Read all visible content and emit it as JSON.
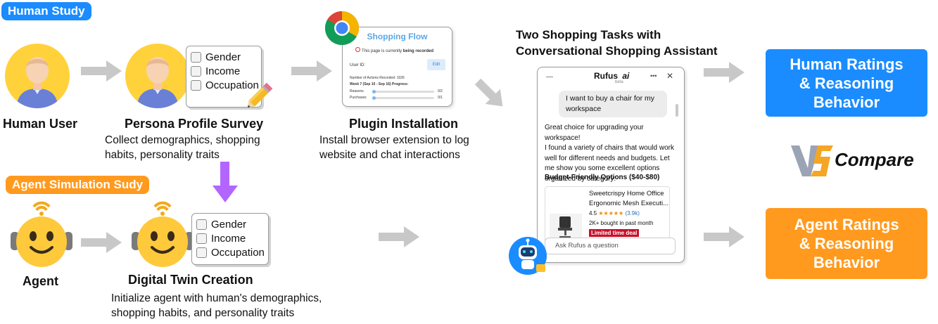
{
  "human_study_tag": "Human Study",
  "agent_study_tag": "Agent Simulation Sudy",
  "human_user_label": "Human User",
  "agent_label": "Agent",
  "persona_survey": {
    "title": "Persona Profile Survey",
    "desc_line1": "Collect demographics, shopping",
    "desc_line2": "habits, personality traits",
    "fields": [
      "Gender",
      "Income",
      "Occupation"
    ]
  },
  "digital_twin": {
    "title": "Digital Twin Creation",
    "desc_line1": "Initialize agent with human's demographics,",
    "desc_line2": "shopping habits, and personality traits",
    "fields": [
      "Gender",
      "Income",
      "Occupation"
    ]
  },
  "plugin": {
    "title": "Plugin Installation",
    "desc_line1": "Install browser extension to log",
    "desc_line2": "website and chat interactions",
    "screenshot": {
      "title": "Shopping Flow",
      "recording_prefix": "This page is currently ",
      "recording_bold": "being recorded",
      "user_id_label": "User ID:",
      "edit_button": "Edit",
      "actions_recorded": "Number of Actions Recorded: 1026",
      "week_progress": "Week 7 (Sep 10 - Sep 16) Progress:",
      "reasons_label": "Reasons",
      "reasons_count": "0/2",
      "purchases_label": "Purchases",
      "purchases_count": "0/1"
    }
  },
  "shopping_tasks": {
    "title_line1": "Two Shopping Tasks with",
    "title_line2": "Conversational Shopping Assistant"
  },
  "rufus": {
    "name": "Rufus",
    "logo_mark": "ai",
    "badge": "beta",
    "menu_glyph": "•••",
    "close_glyph": "✕",
    "minimize_glyph": "—",
    "user_msg_line1": "I want to buy a chair for my",
    "user_msg_line2": "workspace",
    "reply_lines": [
      "Great choice for upgrading your workspace!",
      "I found a variety of chairs that would work",
      "well for different needs and budgets. Let",
      "me show you some excellent options",
      "organized by category:"
    ],
    "budget_heading": "Budget-Friendly Options ($40-$80)",
    "product_line1": "Sweetcrispy Home Office",
    "product_line2": "Ergonomic Mesh Executi...",
    "rating": "4.5",
    "stars": "★★★★★",
    "review_count": "(3.9k)",
    "bought_text": "2K+ bought in past month",
    "deal_badge": "Limited time deal",
    "input_placeholder": "Ask Rufus a question"
  },
  "human_ratings": {
    "line1": "Human Ratings",
    "line2": "& Reasoning",
    "line3": "Behavior"
  },
  "agent_ratings": {
    "line1": "Agent Ratings",
    "line2": "& Reasoning",
    "line3": "Behavior"
  },
  "compare": {
    "logo_text": "VS",
    "label": "Compare"
  },
  "colors": {
    "human_blue": "#1a8cff",
    "agent_orange": "#ff9a1f",
    "arrow_gray": "#c8c8c8",
    "down_arrow_purple": "#b266ff",
    "avatar_yellow": "#ffd23c",
    "deal_red": "#c7102a",
    "star_orange": "#f08a00"
  }
}
